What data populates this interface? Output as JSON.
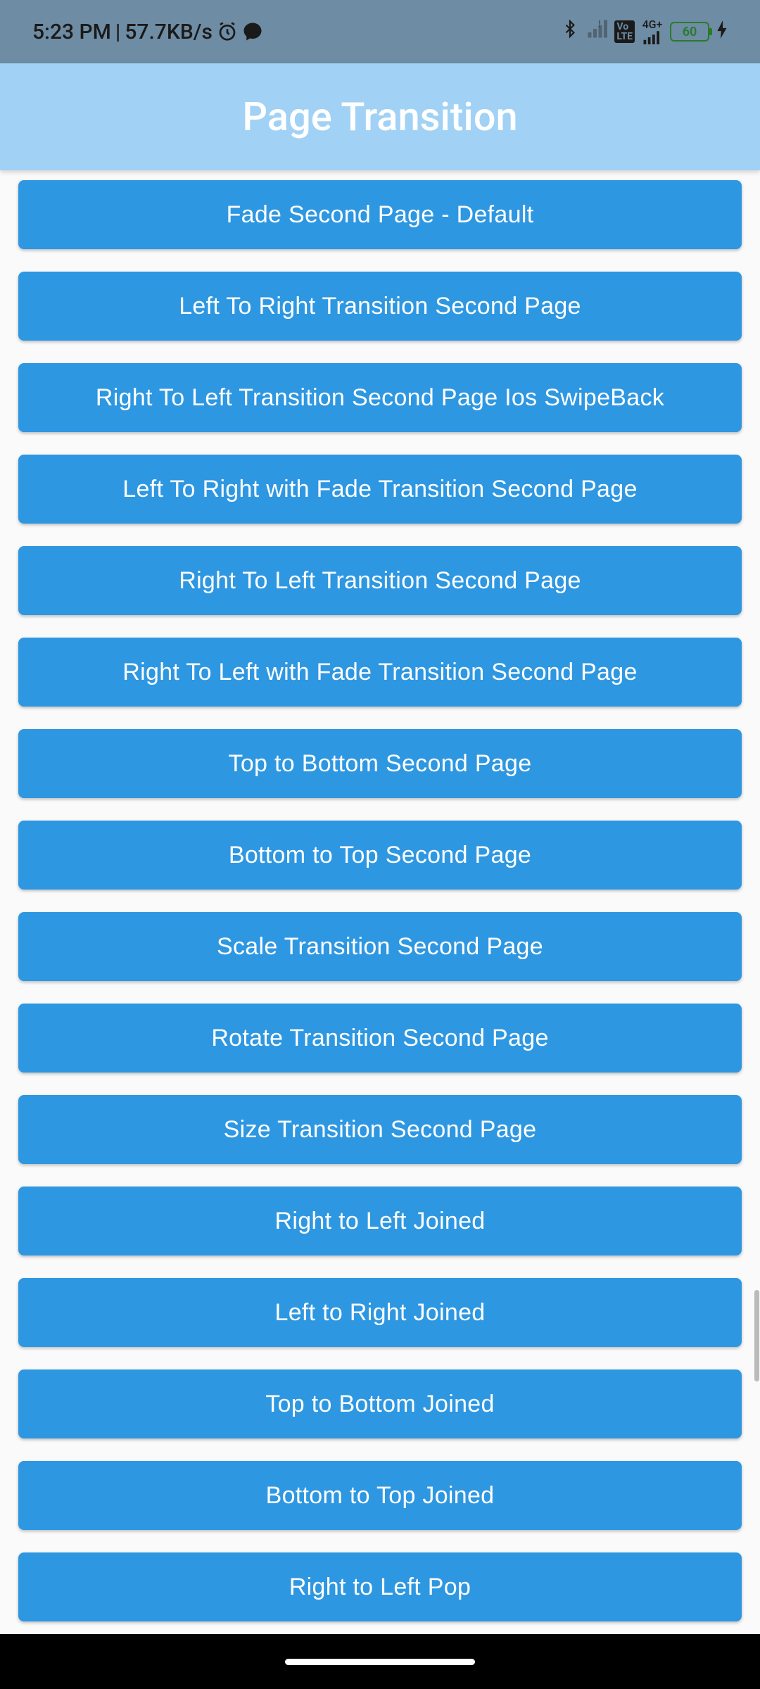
{
  "status": {
    "time": "5:23 PM",
    "separator": " | ",
    "network_speed": "57.7KB/s",
    "network_type": "4G+",
    "lte_badge": "Vo LTE",
    "battery_level": "60"
  },
  "app_bar": {
    "title": "Page Transition"
  },
  "buttons": [
    "Fade Second Page - Default",
    "Left To Right Transition Second Page",
    "Right To Left Transition Second Page Ios SwipeBack",
    "Left To Right with Fade Transition Second Page",
    "Right To Left Transition Second Page",
    "Right To Left with Fade Transition Second Page",
    "Top to Bottom Second Page",
    "Bottom to Top Second Page",
    "Scale Transition Second Page",
    "Rotate Transition Second Page",
    "Size Transition Second Page",
    "Right to Left Joined",
    "Left to Right Joined",
    "Top to Bottom Joined",
    "Bottom to Top Joined",
    "Right to Left Pop"
  ]
}
